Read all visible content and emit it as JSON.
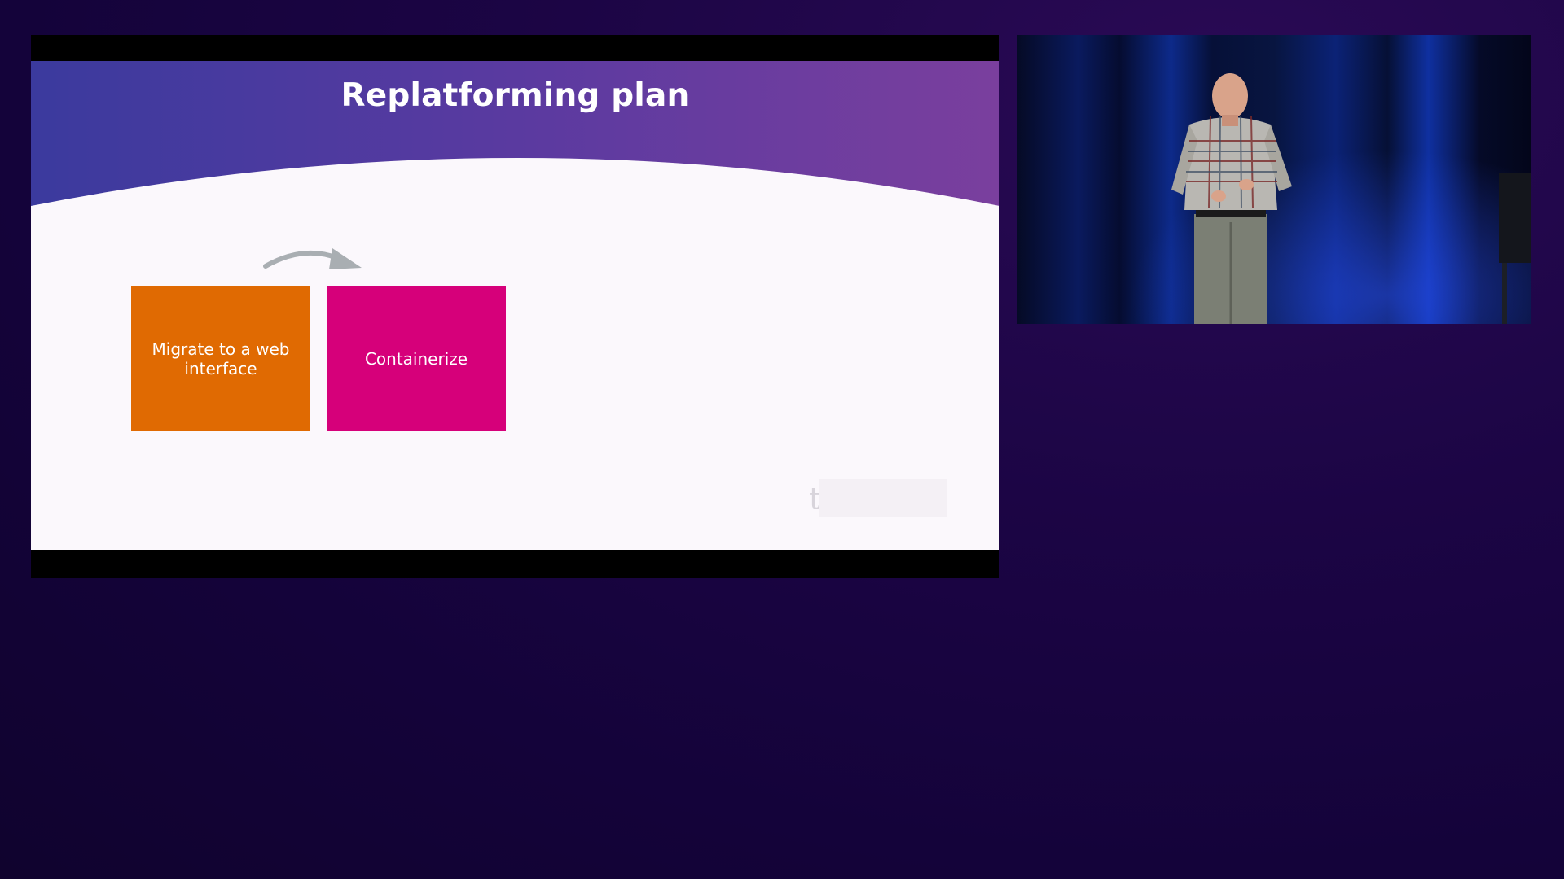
{
  "slide": {
    "title": "Replatforming plan",
    "boxes": [
      {
        "label": "Migrate to a web interface",
        "color": "#e06a02"
      },
      {
        "label": "Containerize",
        "color": "#d6007a"
      }
    ],
    "faded_text": "t",
    "header_gradient": [
      "#3b3a9e",
      "#5a3aa0",
      "#7a3f9e"
    ],
    "background": "#fbf8fc",
    "arrow_color": "#a9aeb2"
  },
  "video": {
    "subject": "speaker-on-stage",
    "curtain_color": "#0d2a8a"
  },
  "page": {
    "background": "#1a0542"
  }
}
